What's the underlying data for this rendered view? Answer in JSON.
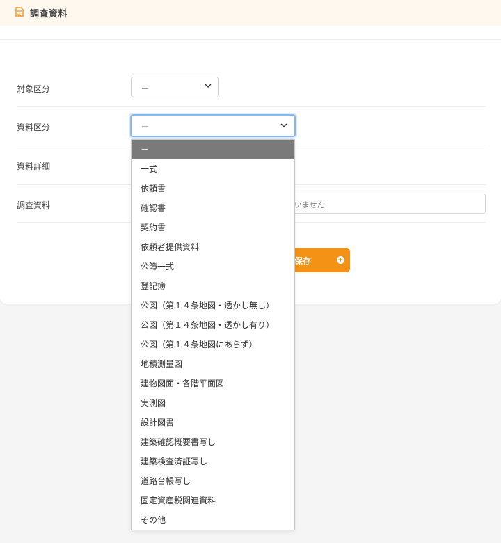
{
  "header": {
    "title": "調査資料",
    "icon": "document-icon",
    "accent": "#f39214"
  },
  "form": {
    "target_label": "対象区分",
    "target_value": "－",
    "material_label": "資料区分",
    "material_value": "－",
    "detail_label": "資料詳細",
    "survey_label": "調査資料",
    "survey_placeholder_visible": "いません"
  },
  "save_button": {
    "label": "保存"
  },
  "dropdown": {
    "options": [
      "－",
      "一式",
      "依頼書",
      "確認書",
      "契約書",
      "依頼者提供資料",
      "公簿一式",
      "登記簿",
      "公図（第１４条地図・透かし無し）",
      "公図（第１４条地図・透かし有り）",
      "公図（第１４条地図にあらず）",
      "地積測量図",
      "建物図面・各階平面図",
      "実測図",
      "設計図書",
      "建築確認概要書写し",
      "建築検査済証写し",
      "道路台帳写し",
      "固定資産税関連資料",
      "その他"
    ],
    "selected_index": 0,
    "selected_color": "#7a7a7a"
  }
}
